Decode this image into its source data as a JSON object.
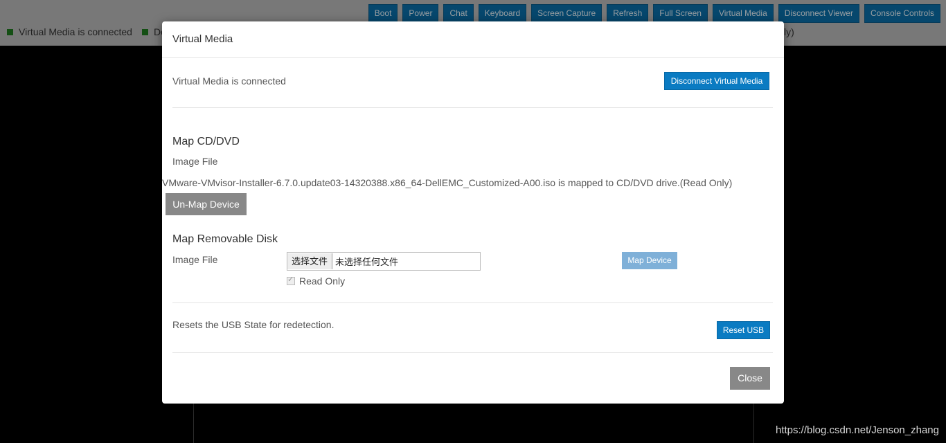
{
  "toolbar": {
    "buttons": [
      "Boot",
      "Power",
      "Chat",
      "Keyboard",
      "Screen Capture",
      "Refresh",
      "Full Screen",
      "Virtual Media",
      "Disconnect Viewer",
      "Console Controls"
    ]
  },
  "status": {
    "left_item_1": "Virtual Media is connected",
    "left_item_2": "De",
    "right_fragment": "ly)",
    "indicator_color": "#1f7a1f"
  },
  "modal": {
    "title": "Virtual Media",
    "connection": {
      "status_text": "Virtual Media is connected",
      "disconnect_label": "Disconnect Virtual Media"
    },
    "cd_dvd": {
      "heading": "Map CD/DVD",
      "image_file_label": "Image File",
      "mapped_text": "VMware-VMvisor-Installer-6.7.0.update03-14320388.x86_64-DellEMC_Customized-A00.iso is mapped to CD/DVD drive.(Read Only)",
      "unmap_label": "Un-Map Device"
    },
    "removable_disk": {
      "heading": "Map Removable Disk",
      "image_file_label": "Image File",
      "choose_file_label": "选择文件",
      "no_file_text": "未选择任何文件",
      "map_device_label": "Map Device",
      "read_only_label": "Read Only"
    },
    "usb": {
      "description": "Resets the USB State for redetection.",
      "reset_label": "Reset USB"
    },
    "close_label": "Close"
  },
  "watermark": "https://blog.csdn.net/Jenson_zhang",
  "colors": {
    "accent": "#0a7bc2",
    "toolbar_button": "#0a6ea8",
    "secondary_button": "#888888",
    "disabled_button": "#7fb0d8"
  }
}
